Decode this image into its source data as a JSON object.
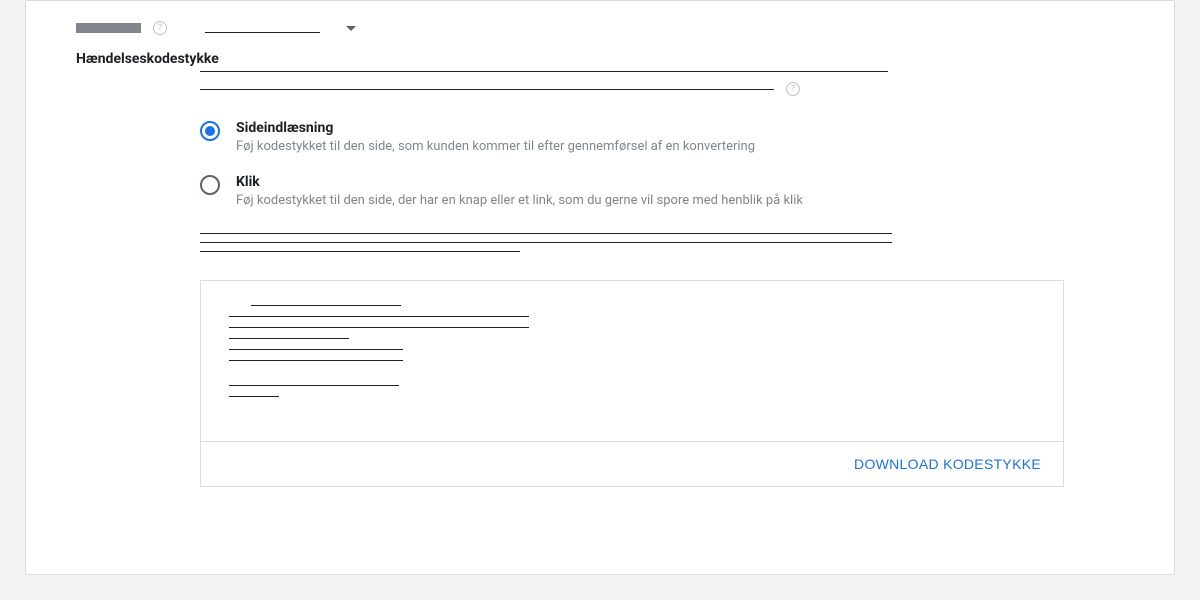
{
  "section": {
    "title": "Hændelseskodestykke"
  },
  "radios": {
    "page_load": {
      "label": "Sideindlæsning",
      "description": "Føj kodestykket til den side, som kunden kommer til efter gennemførsel af en konvertering",
      "selected": true
    },
    "click": {
      "label": "Klik",
      "description": "Føj kodestykket til den side, der har en knap eller et link, som du gerne vil spore med henblik på klik",
      "selected": false
    }
  },
  "buttons": {
    "download": "Download kodestykke"
  },
  "help_glyph": "?"
}
